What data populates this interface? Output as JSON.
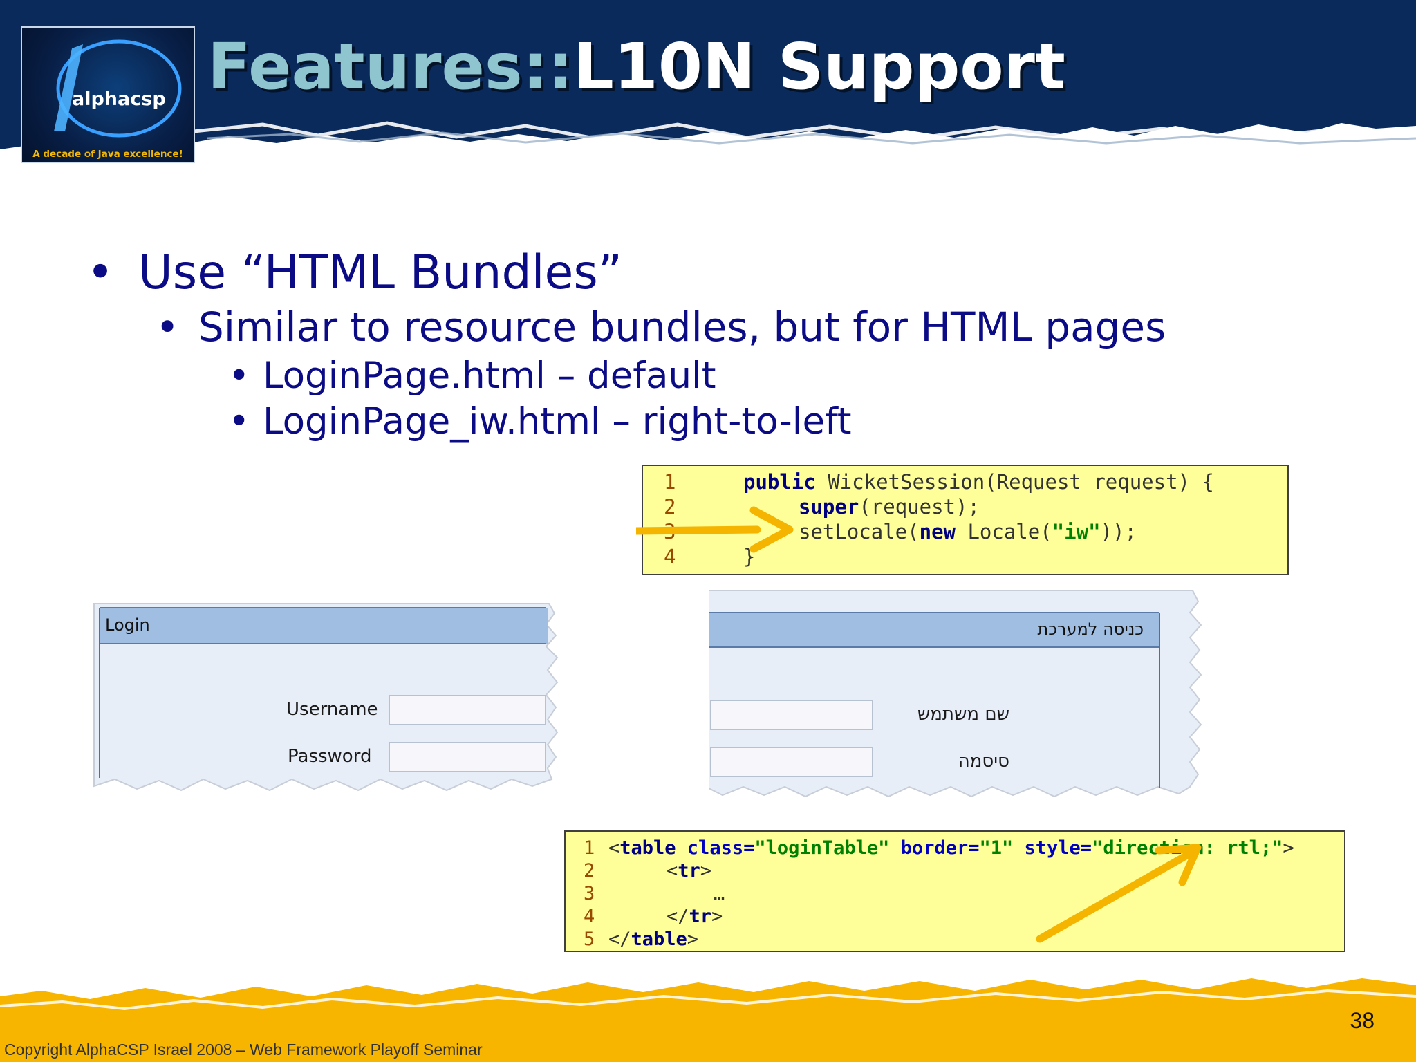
{
  "logo": {
    "brand_plain": "alpha",
    "brand_bold": "csp",
    "tagline": "A decade of Java excellence!"
  },
  "title": {
    "prefix": "Features::",
    "main": "L10N Support"
  },
  "bullets": {
    "level1": "Use “HTML Bundles”",
    "level2": "Similar to resource bundles, but for HTML pages",
    "level3": [
      "LoginPage.html – default",
      "LoginPage_iw.html – right-to-left"
    ]
  },
  "code_java": {
    "line_numbers": [
      "1",
      "2",
      "3",
      "4"
    ],
    "l1_kw": "public",
    "l1_rest": " WicketSession(Request request) {",
    "l2_kw": "super",
    "l2_rest": "(request);",
    "l3_a": "setLocale(",
    "l3_kw": "new",
    "l3_b": " Locale(",
    "l3_str": "\"iw\"",
    "l3_c": "));",
    "l4": "}"
  },
  "code_html": {
    "line_numbers": [
      "1",
      "2",
      "3",
      "4",
      "5"
    ],
    "l1_open": "<",
    "l1_tag": "table",
    "l1_attr1": " class=",
    "l1_val1": "\"loginTable\"",
    "l1_attr2": " border=",
    "l1_val2": "\"1\"",
    "l1_attr3": " style=",
    "l1_val3a": "\"",
    "l1_val3b": "direction: rtl;",
    "l1_val3c": "\"",
    "l1_close": ">",
    "l2_open": "<",
    "l2_tag": "tr",
    "l2_close": ">",
    "l3": "…",
    "l4_open": "</",
    "l4_tag": "tr",
    "l4_close": ">",
    "l5_open": "</",
    "l5_tag": "table",
    "l5_close": ">"
  },
  "login_ltr": {
    "header": "Login",
    "username_label": "Username",
    "password_label": "Password"
  },
  "login_rtl": {
    "header": "כניסה למערכת",
    "username_label": "שם משתמש",
    "password_label": "סיסמה"
  },
  "footer": {
    "page_number": "38",
    "copyright": "Copyright AlphaCSP Israel 2008 – Web Framework Playoff Seminar"
  },
  "colors": {
    "header_bg": "#0a2a5c",
    "title_prefix": "#8fc5cf",
    "bullet_text": "#0b0b86",
    "code_bg": "#ffff99",
    "arrow": "#f5b400",
    "footer_orange": "#f7b500"
  }
}
